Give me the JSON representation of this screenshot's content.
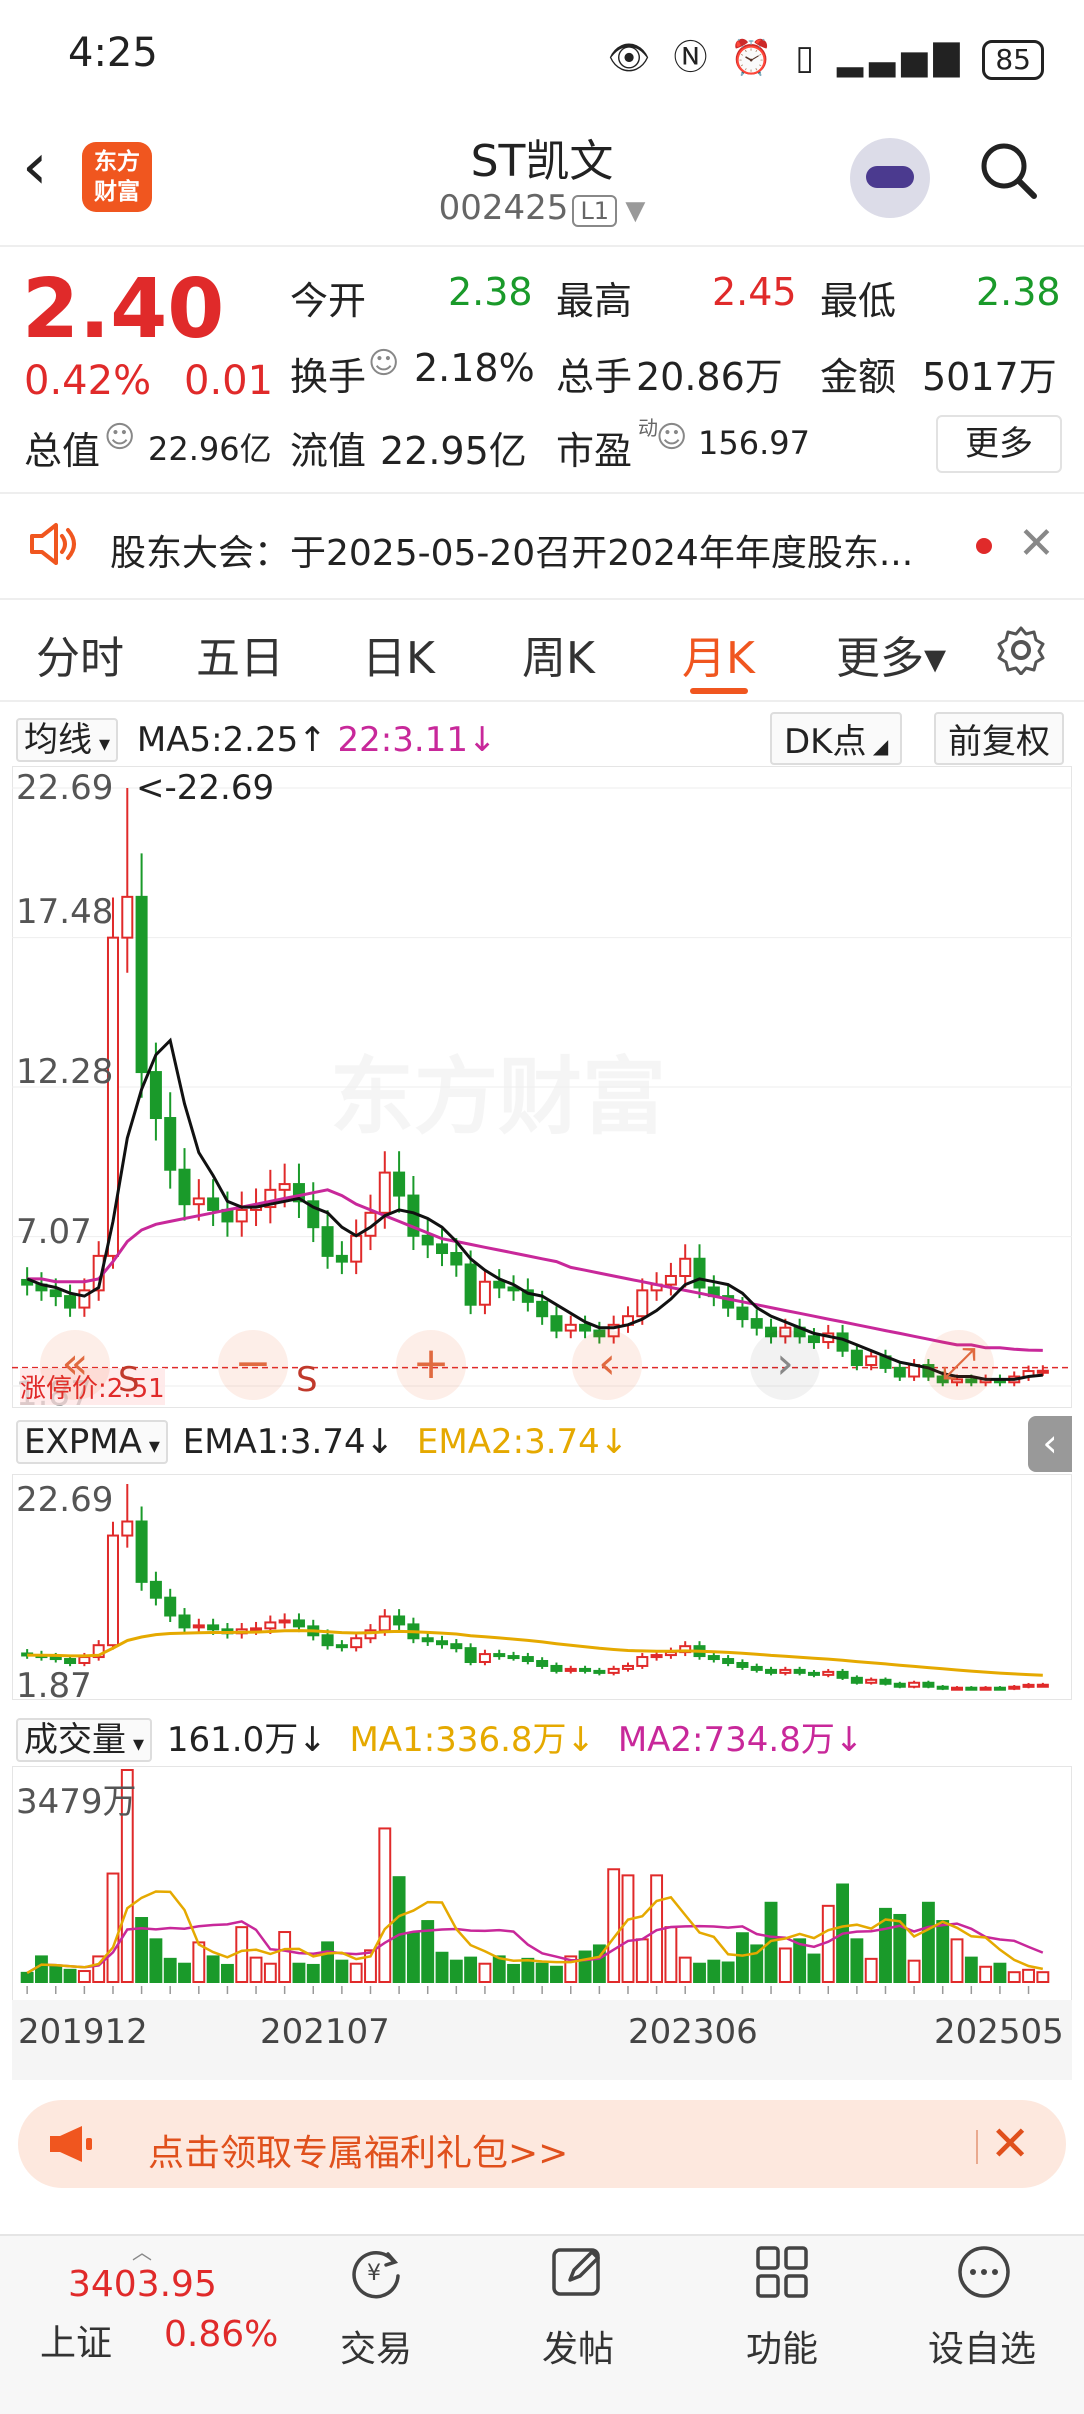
{
  "status_bar": {
    "time": "4:25",
    "battery": "85"
  },
  "header": {
    "logo_text": "东方\n财富",
    "title": "ST凯文",
    "code": "002425",
    "level_tag": "L1"
  },
  "quote": {
    "price": "2.40",
    "change_pct": "0.42%",
    "change": "0.01",
    "open_label": "今开",
    "open": "2.38",
    "high_label": "最高",
    "high": "2.45",
    "low_label": "最低",
    "low": "2.38",
    "turnover_label": "换手",
    "turnover": "2.18%",
    "volume_label": "总手",
    "volume": "20.86万",
    "amount_label": "金额",
    "amount": "5017万",
    "mktcap_label": "总值",
    "mktcap": "22.96亿",
    "float_label": "流值",
    "float_cap": "22.95亿",
    "pe_label": "市盈",
    "pe_sup": "动",
    "pe": "156.97",
    "more_label": "更多"
  },
  "notice": {
    "text": "股东大会：于2025-05-20召开2024年年度股东..."
  },
  "tabs": [
    {
      "label": "分时"
    },
    {
      "label": "五日"
    },
    {
      "label": "日K"
    },
    {
      "label": "周K"
    },
    {
      "label": "月K",
      "active": true
    },
    {
      "label": "更多▾"
    }
  ],
  "main_chart": {
    "indicator_select": "均线",
    "ma5_text": "MA5:2.25↑",
    "ma22_text": "22:3.11↓",
    "dk_label": "DK点",
    "adjust_label": "前复权",
    "y_ticks": [
      "22.69",
      "17.48",
      "12.28",
      "7.07",
      "1.87"
    ],
    "max_marker": "<-22.69",
    "limit_label": "涨停价:2.51",
    "s_label_1": "S",
    "s_label_2": "S",
    "min_marker": "1.87"
  },
  "expma_panel": {
    "select": "EXPMA",
    "ema1_text": "EMA1:3.74↓",
    "ema2_text": "EMA2:3.74↓",
    "y_top": "22.69",
    "y_bottom": "1.87"
  },
  "volume_panel": {
    "select": "成交量",
    "vol_text": "161.0万↓",
    "ma1_text": "MA1:336.8万↓",
    "ma2_text": "MA2:734.8万↓",
    "y_top": "3479万"
  },
  "x_labels": [
    "201912",
    "202107",
    "202306",
    "202505"
  ],
  "colors": {
    "up": "#e02a2a",
    "down": "#1a9a2a",
    "ma5": "#111111",
    "ma22": "#c8289a",
    "ema2": "#e5a900",
    "accent": "#f0561f"
  },
  "chart_data": {
    "type": "candlestick",
    "period": "monthly",
    "ylim": [
      1.87,
      22.69
    ],
    "close": [
      5.4,
      5.2,
      5.0,
      4.6,
      5.2,
      6.4,
      17.48,
      18.9,
      12.8,
      11.2,
      9.4,
      8.2,
      8.4,
      8.0,
      7.6,
      8.0,
      8.1,
      8.7,
      8.9,
      8.3,
      7.4,
      6.4,
      6.2,
      7.1,
      7.9,
      9.3,
      8.5,
      7.1,
      6.8,
      6.5,
      6.1,
      4.7,
      5.5,
      5.3,
      5.2,
      4.8,
      4.3,
      3.8,
      4.0,
      3.8,
      3.6,
      4.0,
      4.3,
      5.2,
      5.4,
      5.7,
      6.3,
      5.3,
      5.0,
      4.6,
      4.2,
      3.9,
      3.6,
      3.9,
      3.6,
      3.4,
      3.7,
      3.1,
      2.6,
      2.9,
      2.5,
      2.2,
      2.6,
      2.2,
      2.0,
      2.1,
      2.0,
      2.1,
      2.0,
      2.2,
      2.39,
      2.4
    ],
    "ma5": [
      5.6,
      5.4,
      5.3,
      5.1,
      5.0,
      5.3,
      7.6,
      10.5,
      12.2,
      13.4,
      13.9,
      11.7,
      10.0,
      9.2,
      8.3,
      8.1,
      8.1,
      8.2,
      8.3,
      8.4,
      8.1,
      7.9,
      7.4,
      7.1,
      7.4,
      7.8,
      8.0,
      7.9,
      7.7,
      7.4,
      6.9,
      6.3,
      5.9,
      5.6,
      5.4,
      5.1,
      5.0,
      4.7,
      4.4,
      4.1,
      3.9,
      3.9,
      4.0,
      4.2,
      4.5,
      4.9,
      5.4,
      5.6,
      5.5,
      5.4,
      5.1,
      4.6,
      4.3,
      4.1,
      3.9,
      3.7,
      3.6,
      3.5,
      3.3,
      3.1,
      2.9,
      2.7,
      2.6,
      2.5,
      2.3,
      2.2,
      2.2,
      2.1,
      2.1,
      2.1,
      2.2,
      2.25
    ],
    "ma22": [
      5.6,
      5.6,
      5.5,
      5.5,
      5.5,
      5.6,
      6.2,
      6.9,
      7.3,
      7.5,
      7.6,
      7.7,
      7.8,
      7.9,
      8.0,
      8.1,
      8.2,
      8.3,
      8.4,
      8.5,
      8.6,
      8.7,
      8.5,
      8.2,
      8.0,
      7.8,
      7.6,
      7.4,
      7.2,
      7.0,
      6.9,
      6.8,
      6.7,
      6.6,
      6.5,
      6.4,
      6.3,
      6.2,
      6.0,
      5.9,
      5.8,
      5.7,
      5.6,
      5.5,
      5.4,
      5.3,
      5.2,
      5.1,
      5.0,
      4.9,
      4.8,
      4.7,
      4.6,
      4.5,
      4.4,
      4.3,
      4.2,
      4.1,
      4.0,
      3.9,
      3.8,
      3.7,
      3.6,
      3.5,
      3.4,
      3.3,
      3.3,
      3.2,
      3.2,
      3.15,
      3.12,
      3.11
    ],
    "volume_wan": [
      150,
      420,
      260,
      200,
      180,
      420,
      1780,
      3479,
      1050,
      700,
      380,
      300,
      650,
      420,
      280,
      900,
      400,
      300,
      820,
      300,
      280,
      650,
      350,
      300,
      520,
      2520,
      1720,
      800,
      1000,
      480,
      350,
      400,
      300,
      420,
      280,
      380,
      300,
      250,
      420,
      500,
      600,
      1850,
      1750,
      700,
      1750,
      900,
      400,
      300,
      350,
      320,
      800,
      600,
      1300,
      550,
      700,
      450,
      1250,
      1600,
      700,
      380,
      1200,
      1100,
      350,
      1300,
      1000,
      700,
      400,
      250,
      300,
      161,
      200,
      161
    ],
    "ema_level": 3.74,
    "ma1_vol_wan": 336.8,
    "ma2_vol_wan": 734.8,
    "x_ticks": [
      "201912",
      "202107",
      "202306",
      "202505"
    ]
  },
  "promo": {
    "text": "点击领取专属福利礼包>>"
  },
  "bottom_nav": {
    "index_value": "3403.95",
    "index_name": "上证",
    "index_change": "0.86%",
    "items": [
      {
        "label": "交易"
      },
      {
        "label": "发帖"
      },
      {
        "label": "功能"
      },
      {
        "label": "设自选"
      }
    ]
  }
}
